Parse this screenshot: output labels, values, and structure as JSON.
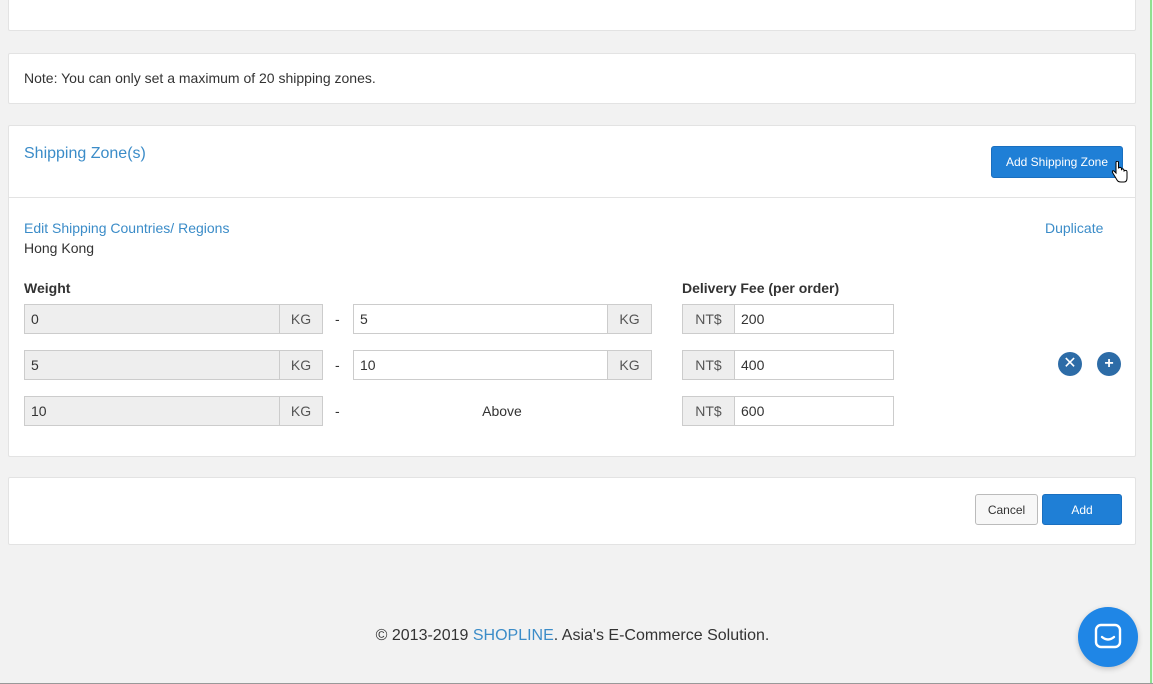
{
  "note": {
    "text": "Note: You can only set a maximum of 20 shipping zones."
  },
  "zones": {
    "title": "Shipping Zone(s)",
    "add_button": "Add Shipping Zone",
    "edit_link": "Edit Shipping Countries/ Regions",
    "region": "Hong Kong",
    "duplicate_link": "Duplicate",
    "weight_label": "Weight",
    "fee_label": "Delivery Fee (per order)",
    "unit": "KG",
    "currency": "NT$",
    "dash": "-",
    "rows": [
      {
        "from": "0",
        "to": "5",
        "fee": "200"
      },
      {
        "from": "5",
        "to": "10",
        "fee": "400"
      },
      {
        "from": "10",
        "to_text": "Above",
        "fee": "600"
      }
    ]
  },
  "actions": {
    "cancel": "Cancel",
    "add": "Add"
  },
  "footer": {
    "prefix": "© 2013-2019 ",
    "brand": "SHOPLINE",
    "suffix": ". Asia's E-Commerce Solution."
  },
  "colors": {
    "accent": "#1f7fd6",
    "link": "#3b8cc8",
    "icon": "#2d6ca7"
  },
  "icons": {
    "remove": "remove-circle-icon",
    "add": "add-circle-icon",
    "chat": "chat-icon",
    "cursor": "hand-pointer-icon"
  }
}
